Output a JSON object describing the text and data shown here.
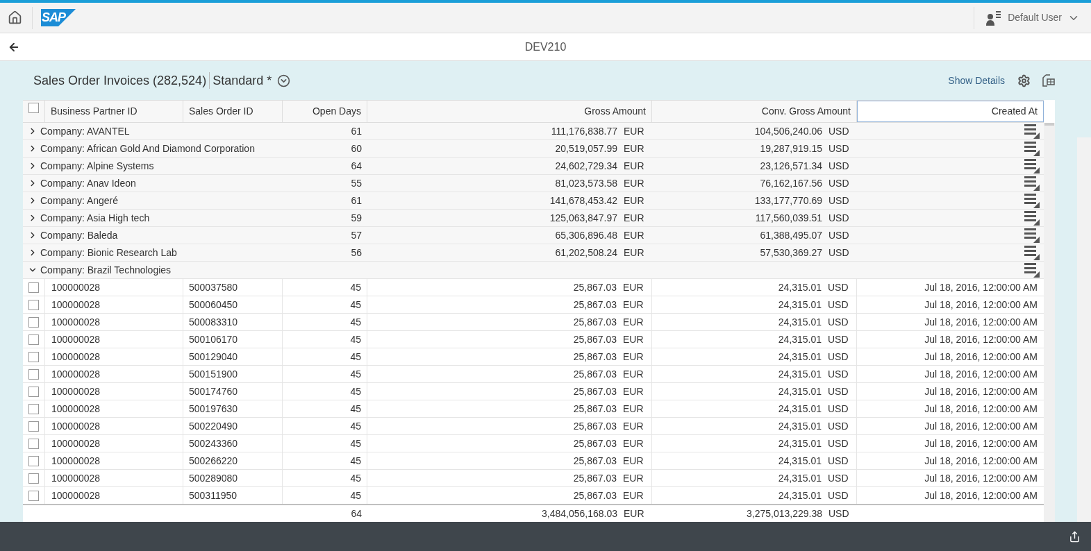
{
  "shell": {
    "logo_text": "SAP",
    "user": "Default User"
  },
  "nav": {
    "title": "DEV210"
  },
  "toolbar": {
    "title": "Sales Order Invoices (282,524)",
    "variant": "Standard *",
    "show_details": "Show Details"
  },
  "table": {
    "select_all": {
      "checked": false
    },
    "columns": [
      "Business Partner ID",
      "Sales Order ID",
      "Open Days",
      "Gross Amount",
      "Conv. Gross Amount",
      "Created At"
    ],
    "rows": [
      {
        "kind": "group",
        "expanded": false,
        "label": "Company: AVANTEL",
        "open_days": "61",
        "gross": "111,176,838.77",
        "gross_currency": "EUR",
        "conv": "104,506,240.06",
        "conv_currency": "USD"
      },
      {
        "kind": "group",
        "expanded": false,
        "label": "Company: African Gold And Diamond Corporation",
        "open_days": "60",
        "gross": "20,519,057.99",
        "gross_currency": "EUR",
        "conv": "19,287,919.15",
        "conv_currency": "USD"
      },
      {
        "kind": "group",
        "expanded": false,
        "label": "Company: Alpine Systems",
        "open_days": "64",
        "gross": "24,602,729.34",
        "gross_currency": "EUR",
        "conv": "23,126,571.34",
        "conv_currency": "USD"
      },
      {
        "kind": "group",
        "expanded": false,
        "label": "Company: Anav Ideon",
        "open_days": "55",
        "gross": "81,023,573.58",
        "gross_currency": "EUR",
        "conv": "76,162,167.56",
        "conv_currency": "USD"
      },
      {
        "kind": "group",
        "expanded": false,
        "label": "Company: Angeré",
        "open_days": "61",
        "gross": "141,678,453.42",
        "gross_currency": "EUR",
        "conv": "133,177,770.69",
        "conv_currency": "USD"
      },
      {
        "kind": "group",
        "expanded": false,
        "label": "Company: Asia High tech",
        "open_days": "59",
        "gross": "125,063,847.97",
        "gross_currency": "EUR",
        "conv": "117,560,039.51",
        "conv_currency": "USD"
      },
      {
        "kind": "group",
        "expanded": false,
        "label": "Company: Baleda",
        "open_days": "57",
        "gross": "65,306,896.48",
        "gross_currency": "EUR",
        "conv": "61,388,495.07",
        "conv_currency": "USD"
      },
      {
        "kind": "group",
        "expanded": false,
        "label": "Company: Bionic Research Lab",
        "open_days": "56",
        "gross": "61,202,508.24",
        "gross_currency": "EUR",
        "conv": "57,530,369.27",
        "conv_currency": "USD"
      },
      {
        "kind": "group",
        "expanded": true,
        "label": "Company: Brazil Technologies"
      },
      {
        "kind": "item",
        "selected": false,
        "bp": "100000028",
        "so": "500037580",
        "open_days": "45",
        "gross": "25,867.03",
        "gross_currency": "EUR",
        "conv": "24,315.01",
        "conv_currency": "USD",
        "created": "Jul 18, 2016, 12:00:00 AM"
      },
      {
        "kind": "item",
        "selected": false,
        "bp": "100000028",
        "so": "500060450",
        "open_days": "45",
        "gross": "25,867.03",
        "gross_currency": "EUR",
        "conv": "24,315.01",
        "conv_currency": "USD",
        "created": "Jul 18, 2016, 12:00:00 AM"
      },
      {
        "kind": "item",
        "selected": false,
        "bp": "100000028",
        "so": "500083310",
        "open_days": "45",
        "gross": "25,867.03",
        "gross_currency": "EUR",
        "conv": "24,315.01",
        "conv_currency": "USD",
        "created": "Jul 18, 2016, 12:00:00 AM"
      },
      {
        "kind": "item",
        "selected": false,
        "bp": "100000028",
        "so": "500106170",
        "open_days": "45",
        "gross": "25,867.03",
        "gross_currency": "EUR",
        "conv": "24,315.01",
        "conv_currency": "USD",
        "created": "Jul 18, 2016, 12:00:00 AM"
      },
      {
        "kind": "item",
        "selected": false,
        "bp": "100000028",
        "so": "500129040",
        "open_days": "45",
        "gross": "25,867.03",
        "gross_currency": "EUR",
        "conv": "24,315.01",
        "conv_currency": "USD",
        "created": "Jul 18, 2016, 12:00:00 AM"
      },
      {
        "kind": "item",
        "selected": false,
        "bp": "100000028",
        "so": "500151900",
        "open_days": "45",
        "gross": "25,867.03",
        "gross_currency": "EUR",
        "conv": "24,315.01",
        "conv_currency": "USD",
        "created": "Jul 18, 2016, 12:00:00 AM"
      },
      {
        "kind": "item",
        "selected": false,
        "bp": "100000028",
        "so": "500174760",
        "open_days": "45",
        "gross": "25,867.03",
        "gross_currency": "EUR",
        "conv": "24,315.01",
        "conv_currency": "USD",
        "created": "Jul 18, 2016, 12:00:00 AM"
      },
      {
        "kind": "item",
        "selected": false,
        "bp": "100000028",
        "so": "500197630",
        "open_days": "45",
        "gross": "25,867.03",
        "gross_currency": "EUR",
        "conv": "24,315.01",
        "conv_currency": "USD",
        "created": "Jul 18, 2016, 12:00:00 AM"
      },
      {
        "kind": "item",
        "selected": false,
        "bp": "100000028",
        "so": "500220490",
        "open_days": "45",
        "gross": "25,867.03",
        "gross_currency": "EUR",
        "conv": "24,315.01",
        "conv_currency": "USD",
        "created": "Jul 18, 2016, 12:00:00 AM"
      },
      {
        "kind": "item",
        "selected": false,
        "bp": "100000028",
        "so": "500243360",
        "open_days": "45",
        "gross": "25,867.03",
        "gross_currency": "EUR",
        "conv": "24,315.01",
        "conv_currency": "USD",
        "created": "Jul 18, 2016, 12:00:00 AM"
      },
      {
        "kind": "item",
        "selected": false,
        "bp": "100000028",
        "so": "500266220",
        "open_days": "45",
        "gross": "25,867.03",
        "gross_currency": "EUR",
        "conv": "24,315.01",
        "conv_currency": "USD",
        "created": "Jul 18, 2016, 12:00:00 AM"
      },
      {
        "kind": "item",
        "selected": false,
        "bp": "100000028",
        "so": "500289080",
        "open_days": "45",
        "gross": "25,867.03",
        "gross_currency": "EUR",
        "conv": "24,315.01",
        "conv_currency": "USD",
        "created": "Jul 18, 2016, 12:00:00 AM"
      },
      {
        "kind": "item",
        "selected": false,
        "bp": "100000028",
        "so": "500311950",
        "open_days": "45",
        "gross": "25,867.03",
        "gross_currency": "EUR",
        "conv": "24,315.01",
        "conv_currency": "USD",
        "created": "Jul 18, 2016, 12:00:00 AM"
      }
    ],
    "totals": {
      "open_days": "64",
      "gross": "3,484,056,168.03",
      "gross_currency": "EUR",
      "conv": "3,275,013,229.38",
      "conv_currency": "USD"
    }
  }
}
